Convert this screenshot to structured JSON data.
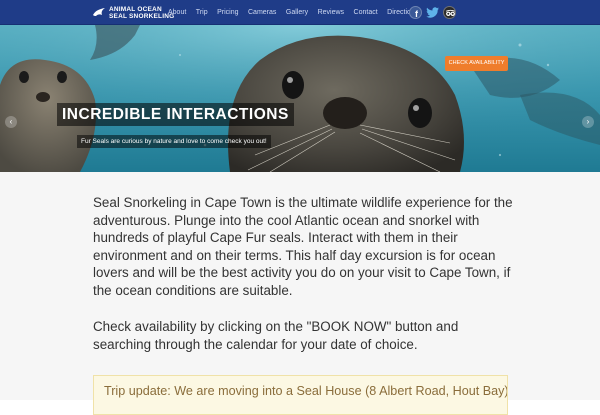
{
  "brand": {
    "line1": "ANIMAL OCEAN",
    "line2": "SEAL SNORKELING"
  },
  "nav": {
    "items": [
      {
        "label": "About"
      },
      {
        "label": "Trip"
      },
      {
        "label": "Pricing"
      },
      {
        "label": "Cameras"
      },
      {
        "label": "Gallery"
      },
      {
        "label": "Reviews"
      },
      {
        "label": "Contact"
      },
      {
        "label": "Directions"
      }
    ],
    "social": [
      {
        "icon": "facebook-icon",
        "glyph": "f"
      },
      {
        "icon": "twitter-icon",
        "glyph": ""
      },
      {
        "icon": "tripadvisor-icon",
        "glyph": ""
      }
    ]
  },
  "hero": {
    "cta_label": "CHECK AVAILABILITY",
    "title": "INCREDIBLE INTERACTIONS",
    "subtitle": "Fur Seals are curious by nature and love to come check you out!",
    "prev_glyph": "‹",
    "next_glyph": "›",
    "slides": [
      {
        "active": true
      },
      {
        "active": false
      },
      {
        "active": false
      },
      {
        "active": false
      },
      {
        "active": false
      },
      {
        "active": false
      }
    ]
  },
  "content": {
    "para1_lead": "Seal Snorkeling",
    "para1_rest": " in Cape Town is the ultimate wildlife experience for the adventurous. Plunge into the cool Atlantic ocean and snorkel with hundreds of playful Cape Fur seals. Interact with them in their environment and on their terms. This half day excursion is for ocean lovers and will be the best activity you do on your visit to Cape Town, if the ocean conditions are suitable.",
    "para2": "Check availability by clicking on the \"BOOK NOW\" button and searching through the calendar for your date of choice.",
    "notice": "Trip update: We are moving into a Seal House (8 Albert Road, Hout Bay),"
  },
  "colors": {
    "nav_bg": "#1f3c88",
    "cta_bg": "#ef7d2c",
    "notice_bg": "#fcf8e3",
    "notice_text": "#8a6d3b"
  }
}
